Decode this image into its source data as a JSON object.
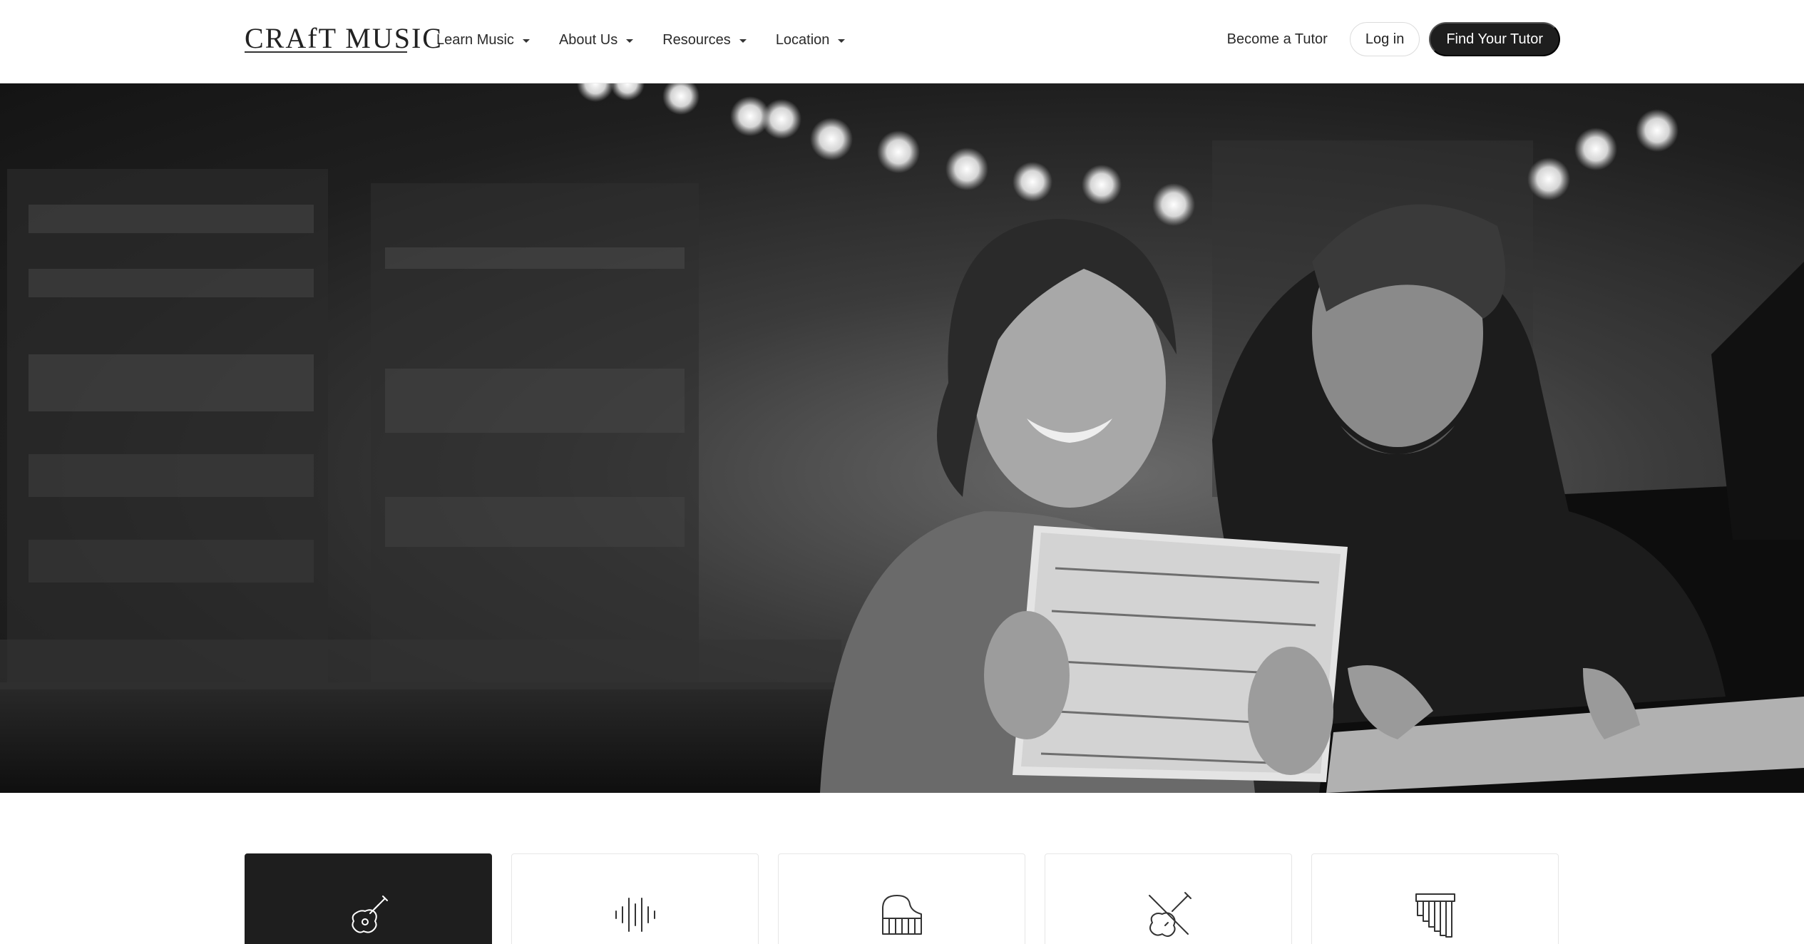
{
  "header": {
    "logo_text": "CRAfT MUSIC",
    "nav": [
      {
        "label": "Learn Music"
      },
      {
        "label": "About Us"
      },
      {
        "label": "Resources"
      },
      {
        "label": "Location"
      }
    ],
    "become_tutor": "Become a Tutor",
    "login": "Log in",
    "find_tutor": "Find Your Tutor"
  },
  "hero": {
    "image": "teacher-and-student-reading-sheet-music-by-piano"
  },
  "categories": [
    {
      "icon": "guitar-icon",
      "active": true
    },
    {
      "icon": "sound-wave-icon",
      "active": false
    },
    {
      "icon": "piano-icon",
      "active": false
    },
    {
      "icon": "violin-icon",
      "active": false
    },
    {
      "icon": "pan-flute-icon",
      "active": false
    }
  ],
  "colors": {
    "dark": "#1e1e1e",
    "white": "#ffffff",
    "border": "#e6e6e6"
  }
}
